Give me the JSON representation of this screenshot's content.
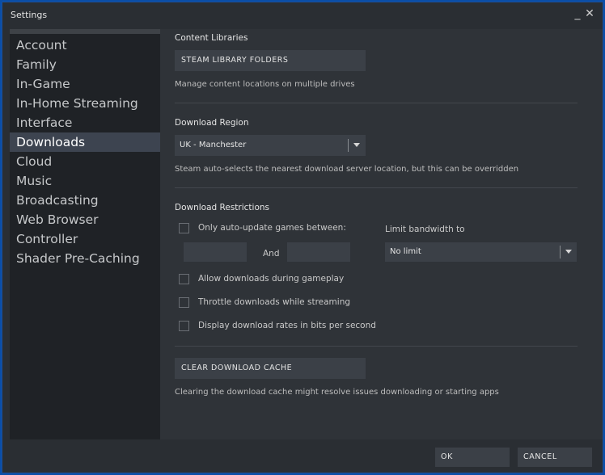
{
  "window": {
    "title": "Settings",
    "minimize_glyph": "_",
    "close_glyph": "✕"
  },
  "sidebar": {
    "items": [
      {
        "label": "Account",
        "active": false
      },
      {
        "label": "Family",
        "active": false
      },
      {
        "label": "In-Game",
        "active": false
      },
      {
        "label": "In-Home Streaming",
        "active": false
      },
      {
        "label": "Interface",
        "active": false
      },
      {
        "label": "Downloads",
        "active": true
      },
      {
        "label": "Cloud",
        "active": false
      },
      {
        "label": "Music",
        "active": false
      },
      {
        "label": "Broadcasting",
        "active": false
      },
      {
        "label": "Web Browser",
        "active": false
      },
      {
        "label": "Controller",
        "active": false
      },
      {
        "label": "Shader Pre-Caching",
        "active": false
      }
    ]
  },
  "content_libraries": {
    "title": "Content Libraries",
    "button_label": "STEAM LIBRARY FOLDERS",
    "description": "Manage content locations on multiple drives"
  },
  "download_region": {
    "title": "Download Region",
    "selected": "UK - Manchester",
    "description": "Steam auto-selects the nearest download server location, but this can be overridden"
  },
  "download_restrictions": {
    "title": "Download Restrictions",
    "auto_update_label": "Only auto-update games between:",
    "auto_update_checked": false,
    "start_time_value": "",
    "and_label": "And",
    "end_time_value": "",
    "bandwidth_label": "Limit bandwidth to",
    "bandwidth_selected": "No limit",
    "options": [
      {
        "label": "Allow downloads during gameplay",
        "checked": false
      },
      {
        "label": "Throttle downloads while streaming",
        "checked": false
      },
      {
        "label": "Display download rates in bits per second",
        "checked": false
      }
    ]
  },
  "cache": {
    "button_label": "CLEAR DOWNLOAD CACHE",
    "description": "Clearing the download cache might resolve issues downloading or starting apps"
  },
  "footer": {
    "ok_label": "OK",
    "cancel_label": "CANCEL"
  },
  "colors": {
    "accent_active": "#3d4450",
    "desktop_blue": "#0a4ea8",
    "panel": "#2f3338",
    "sidebar": "#1f2226"
  }
}
